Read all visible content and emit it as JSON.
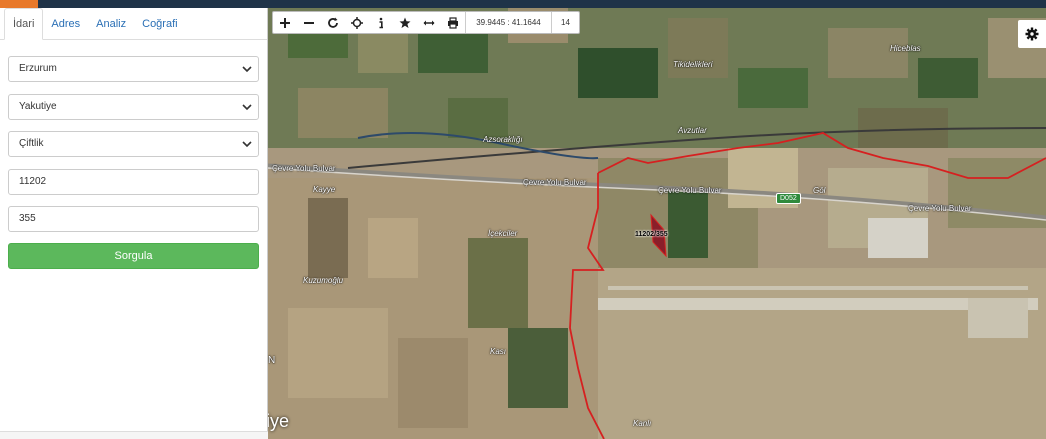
{
  "tabs": [
    "İdari",
    "Adres",
    "Analiz",
    "Coğrafi"
  ],
  "form": {
    "province": "Erzurum",
    "district": "Yakutiye",
    "neighborhood": "Çiftlik",
    "block_no": "11202",
    "parcel_no": "355",
    "query_button": "Sorgula"
  },
  "map": {
    "coords": "39.9445 : 41.1644",
    "zoom": "14",
    "labels": {
      "place_1": "Tikidelikleri",
      "place_2": "Hiceblas",
      "place_3": "Azsoraklığı",
      "place_4": "Avzutlar",
      "place_5": "Kayye",
      "place_6": "İçekciler",
      "place_7": "Kuzumoğlu",
      "place_8": "Kası",
      "place_9": "Kanlı",
      "place_10": "Göl"
    },
    "roads": {
      "r1": "Çevre Yolu Bulvar",
      "r2": "Çevre Yolu Bulvar",
      "r3": "Çevre Yolu Bulvar",
      "r4": "Çevre Yolu Bulvar"
    },
    "shield": "D052",
    "parcel_label": "11202/355",
    "city_text": "iye",
    "city_letter": "N"
  },
  "icons": {
    "zoom_in": "plus-icon",
    "zoom_out": "minus-icon",
    "refresh": "refresh-icon",
    "locate": "crosshair-icon",
    "info": "info-icon",
    "favorite": "star-icon",
    "measure": "measure-icon",
    "print": "print-icon",
    "settings": "gear-icon"
  },
  "colors": {
    "query_button": "#5cb85c",
    "tab_link": "#2a6fb5",
    "boundary": "#d62020",
    "header": "#1f3348",
    "accent": "#e8792b"
  }
}
